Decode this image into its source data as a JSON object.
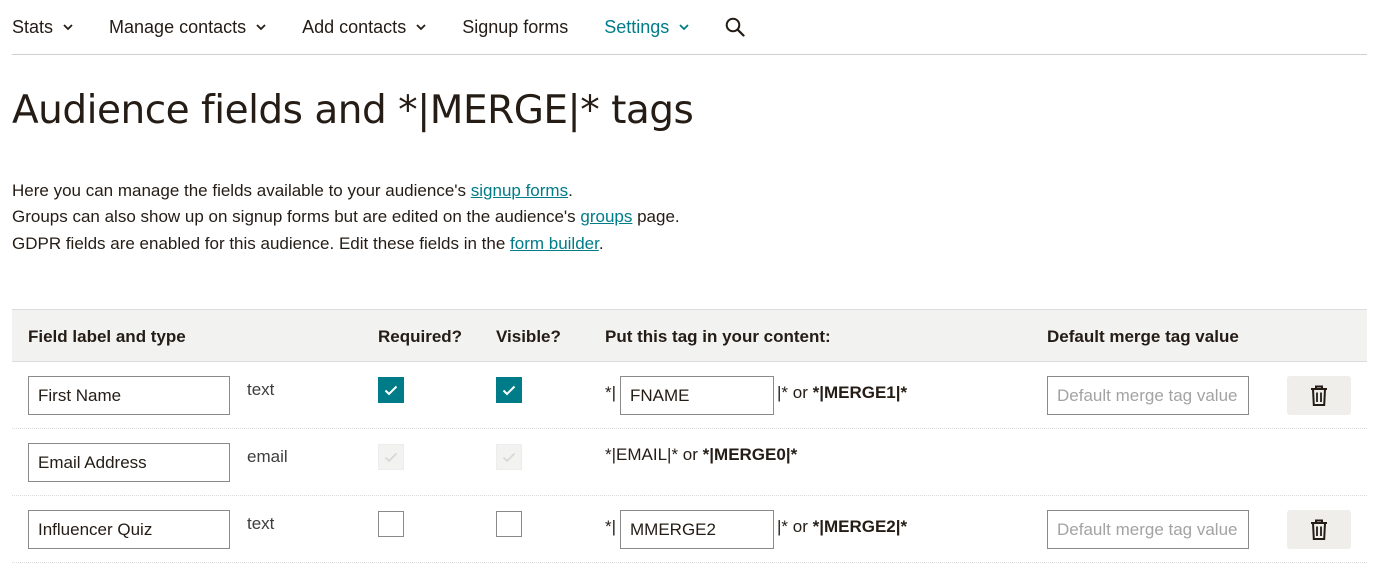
{
  "nav": {
    "items": [
      {
        "label": "Stats",
        "dropdown": true,
        "active": false
      },
      {
        "label": "Manage contacts",
        "dropdown": true,
        "active": false
      },
      {
        "label": "Add contacts",
        "dropdown": true,
        "active": false
      },
      {
        "label": "Signup forms",
        "dropdown": false,
        "active": false
      },
      {
        "label": "Settings",
        "dropdown": true,
        "active": true
      }
    ],
    "search_icon": "search-icon"
  },
  "page_title": "Audience fields and *|MERGE|* tags",
  "intro": {
    "line1_pre": "Here you can manage the fields available to your audience's ",
    "line1_link": "signup forms",
    "line1_post": ".",
    "line2_pre": "Groups can also show up on signup forms but are edited on the audience's ",
    "line2_link": "groups",
    "line2_post": " page.",
    "line3_pre": "GDPR fields are enabled for this audience. Edit these fields in the ",
    "line3_link": "form builder",
    "line3_post": "."
  },
  "table": {
    "headers": {
      "label_type": "Field label and type",
      "required": "Required?",
      "visible": "Visible?",
      "tag": "Put this tag in your content:",
      "default": "Default merge tag value"
    },
    "rows": [
      {
        "label": "First Name",
        "type": "text",
        "required": "checked",
        "visible": "checked",
        "tag_prefix": "*|",
        "tag": "FNAME",
        "tag_suffix": "|* or ",
        "merge": "*|MERGE1|*",
        "default_placeholder": "Default merge tag value",
        "deletable": true
      },
      {
        "label": "Email Address",
        "type": "email",
        "required": "disabled",
        "visible": "disabled",
        "tag_text": "*|EMAIL|* or ",
        "merge": "*|MERGE0|*",
        "deletable": false
      },
      {
        "label": "Influencer Quiz",
        "type": "text",
        "required": "unchecked",
        "visible": "unchecked",
        "tag_prefix": "*|",
        "tag": "MMERGE2",
        "tag_suffix": "|* or ",
        "merge": "*|MERGE2|*",
        "default_placeholder": "Default merge tag value",
        "deletable": true
      }
    ]
  },
  "colors": {
    "accent": "#007c89",
    "text": "#241c15",
    "header_bg": "#f2f2f1",
    "button_bg": "#efeeea"
  },
  "icons": {
    "check": "check-icon",
    "trash": "trash-icon",
    "chevron": "chevron-down-icon"
  }
}
